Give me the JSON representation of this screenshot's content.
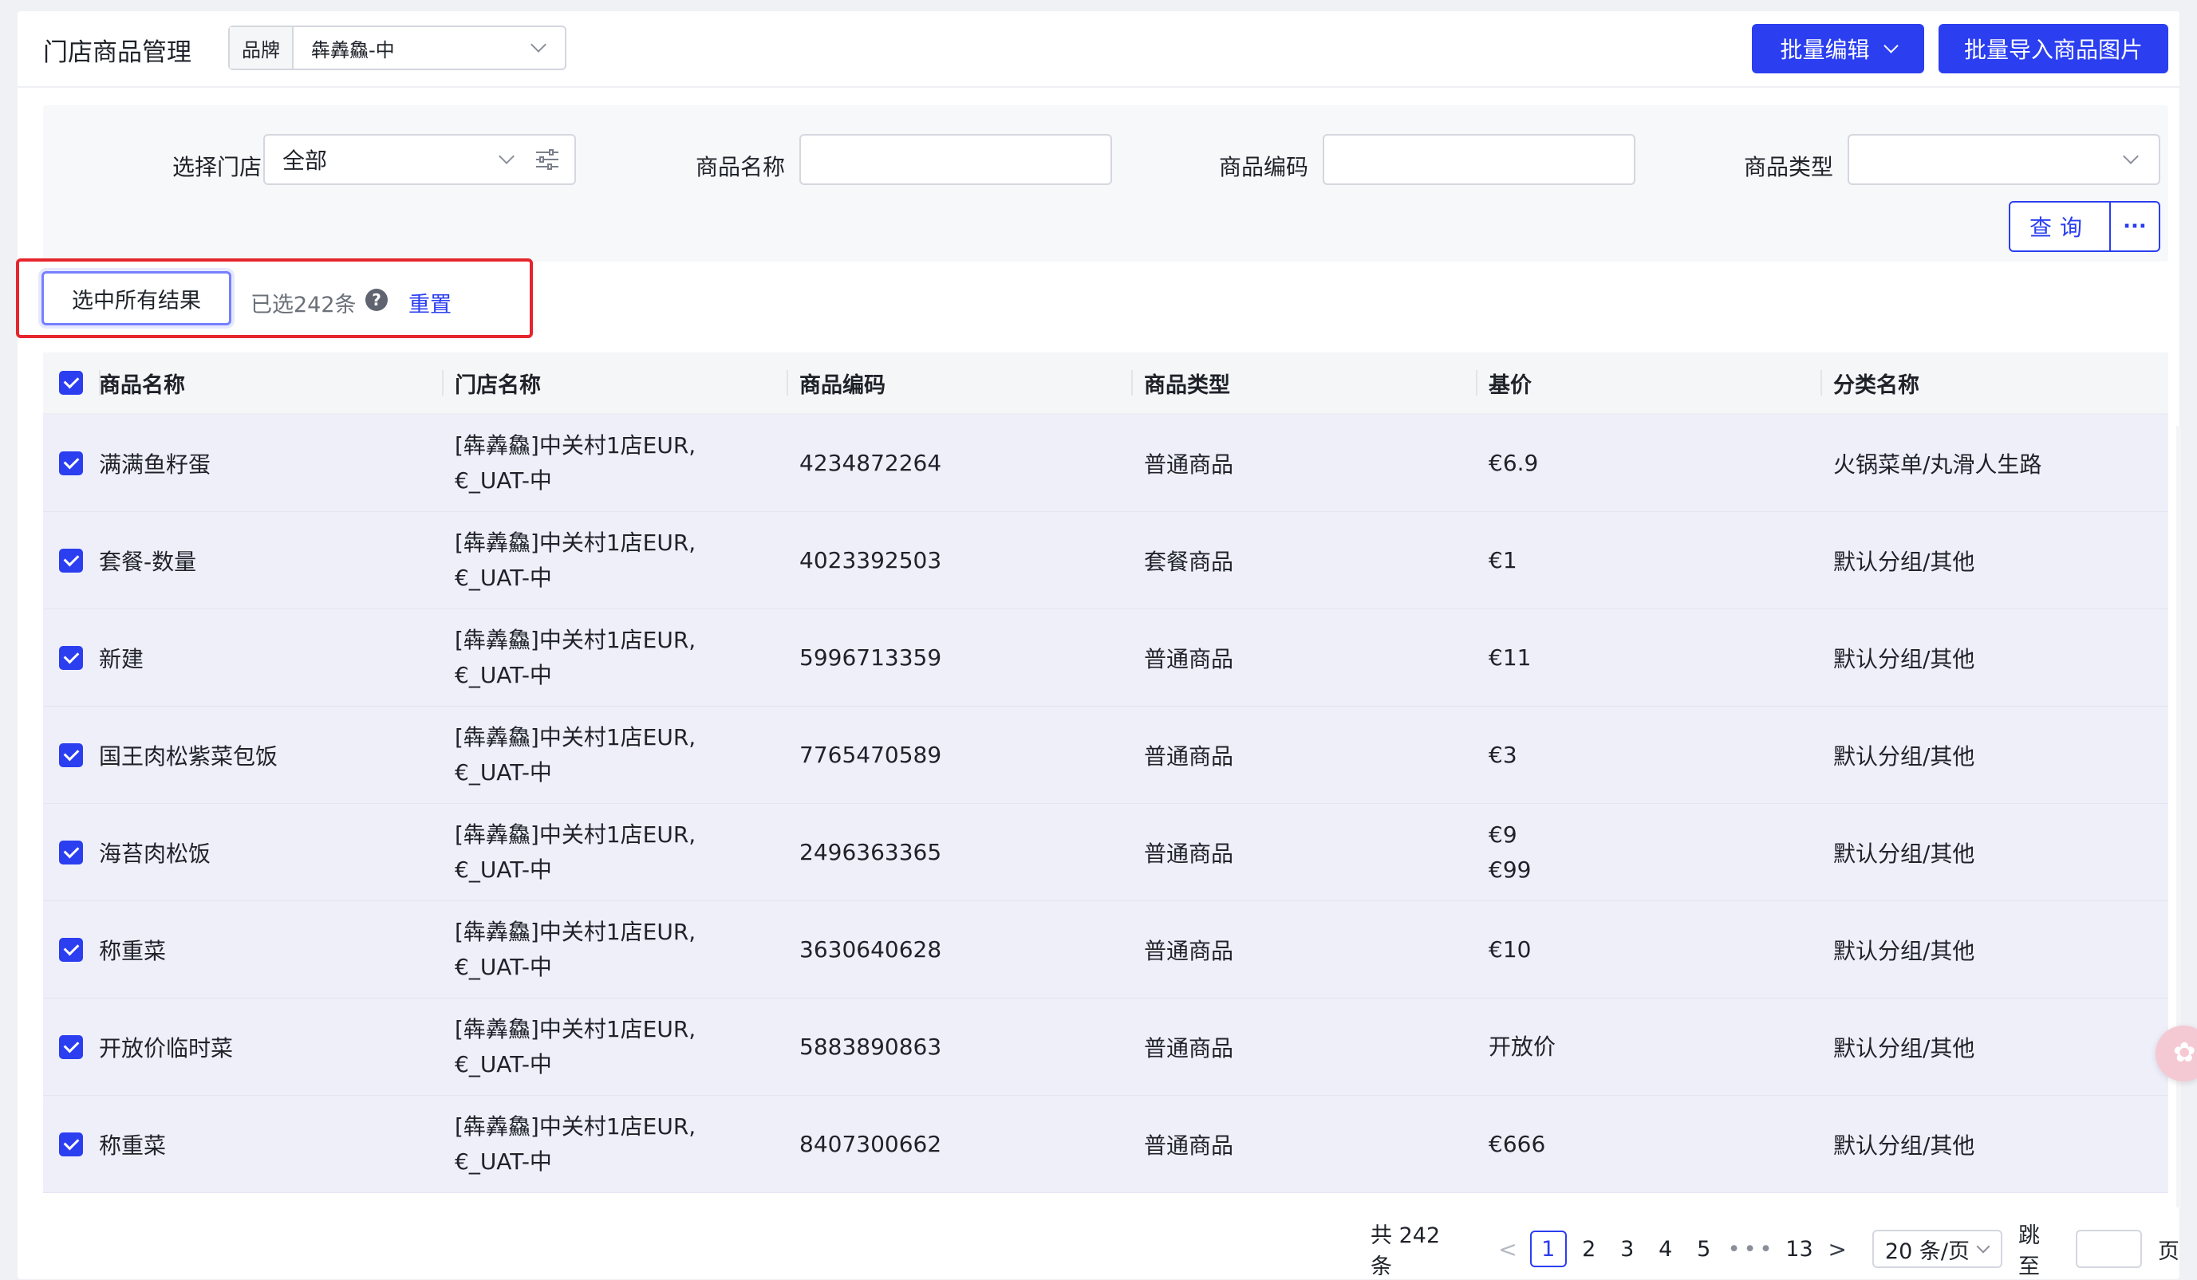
{
  "header": {
    "title": "门店商品管理",
    "brand_label": "品牌",
    "brand_value": "犇羴鱻-中",
    "batch_edit_label": "批量编辑",
    "batch_import_label": "批量导入商品图片"
  },
  "filters": {
    "store_label": "选择门店",
    "store_value": "全部",
    "name_label": "商品名称",
    "name_value": "",
    "code_label": "商品编码",
    "code_value": "",
    "type_label": "商品类型",
    "type_value": "",
    "query_label": "查询",
    "more_label": "···"
  },
  "selection": {
    "select_all_label": "选中所有结果",
    "selected_text": "已选242条",
    "help_icon": "question-circle-icon",
    "reset_label": "重置",
    "highlight_color": "#e6252d"
  },
  "table": {
    "columns": [
      "商品名称",
      "门店名称",
      "商品编码",
      "商品类型",
      "基价",
      "分类名称"
    ],
    "all_checked": true,
    "rows": [
      {
        "checked": true,
        "name": "满满鱼籽蛋",
        "store": "[犇羴鱻]中关村1店EUR,€_UAT-中",
        "code": "4234872264",
        "type": "普通商品",
        "price": [
          "€6.9"
        ],
        "category": "火锅菜单/丸滑人生路"
      },
      {
        "checked": true,
        "name": "套餐-数量",
        "store": "[犇羴鱻]中关村1店EUR,€_UAT-中",
        "code": "4023392503",
        "type": "套餐商品",
        "price": [
          "€1"
        ],
        "category": "默认分组/其他"
      },
      {
        "checked": true,
        "name": "新建",
        "store": "[犇羴鱻]中关村1店EUR,€_UAT-中",
        "code": "5996713359",
        "type": "普通商品",
        "price": [
          "€11"
        ],
        "category": "默认分组/其他"
      },
      {
        "checked": true,
        "name": "国王肉松紫菜包饭",
        "store": "[犇羴鱻]中关村1店EUR,€_UAT-中",
        "code": "7765470589",
        "type": "普通商品",
        "price": [
          "€3"
        ],
        "category": "默认分组/其他"
      },
      {
        "checked": true,
        "name": "海苔肉松饭",
        "store": "[犇羴鱻]中关村1店EUR,€_UAT-中",
        "code": "2496363365",
        "type": "普通商品",
        "price": [
          "€9",
          "€99"
        ],
        "category": "默认分组/其他"
      },
      {
        "checked": true,
        "name": "称重菜",
        "store": "[犇羴鱻]中关村1店EUR,€_UAT-中",
        "code": "3630640628",
        "type": "普通商品",
        "price": [
          "€10"
        ],
        "category": "默认分组/其他"
      },
      {
        "checked": true,
        "name": "开放价临时菜",
        "store": "[犇羴鱻]中关村1店EUR,€_UAT-中",
        "code": "5883890863",
        "type": "普通商品",
        "price": [
          "开放价"
        ],
        "category": "默认分组/其他"
      },
      {
        "checked": true,
        "name": "称重菜",
        "store": "[犇羴鱻]中关村1店EUR,€_UAT-中",
        "code": "8407300662",
        "type": "普通商品",
        "price": [
          "€666"
        ],
        "category": "默认分组/其他"
      }
    ]
  },
  "pagination": {
    "total_text": "共 242 条",
    "pages": [
      "1",
      "2",
      "3",
      "4",
      "5"
    ],
    "ellipsis": "•••",
    "last_page": "13",
    "current_page": "1",
    "page_size": "20 条/页",
    "jump_label": "跳至",
    "page_suffix": "页",
    "jump_value": ""
  },
  "colors": {
    "primary": "#2b3ef0",
    "row_selected_bg": "#efeffa"
  }
}
